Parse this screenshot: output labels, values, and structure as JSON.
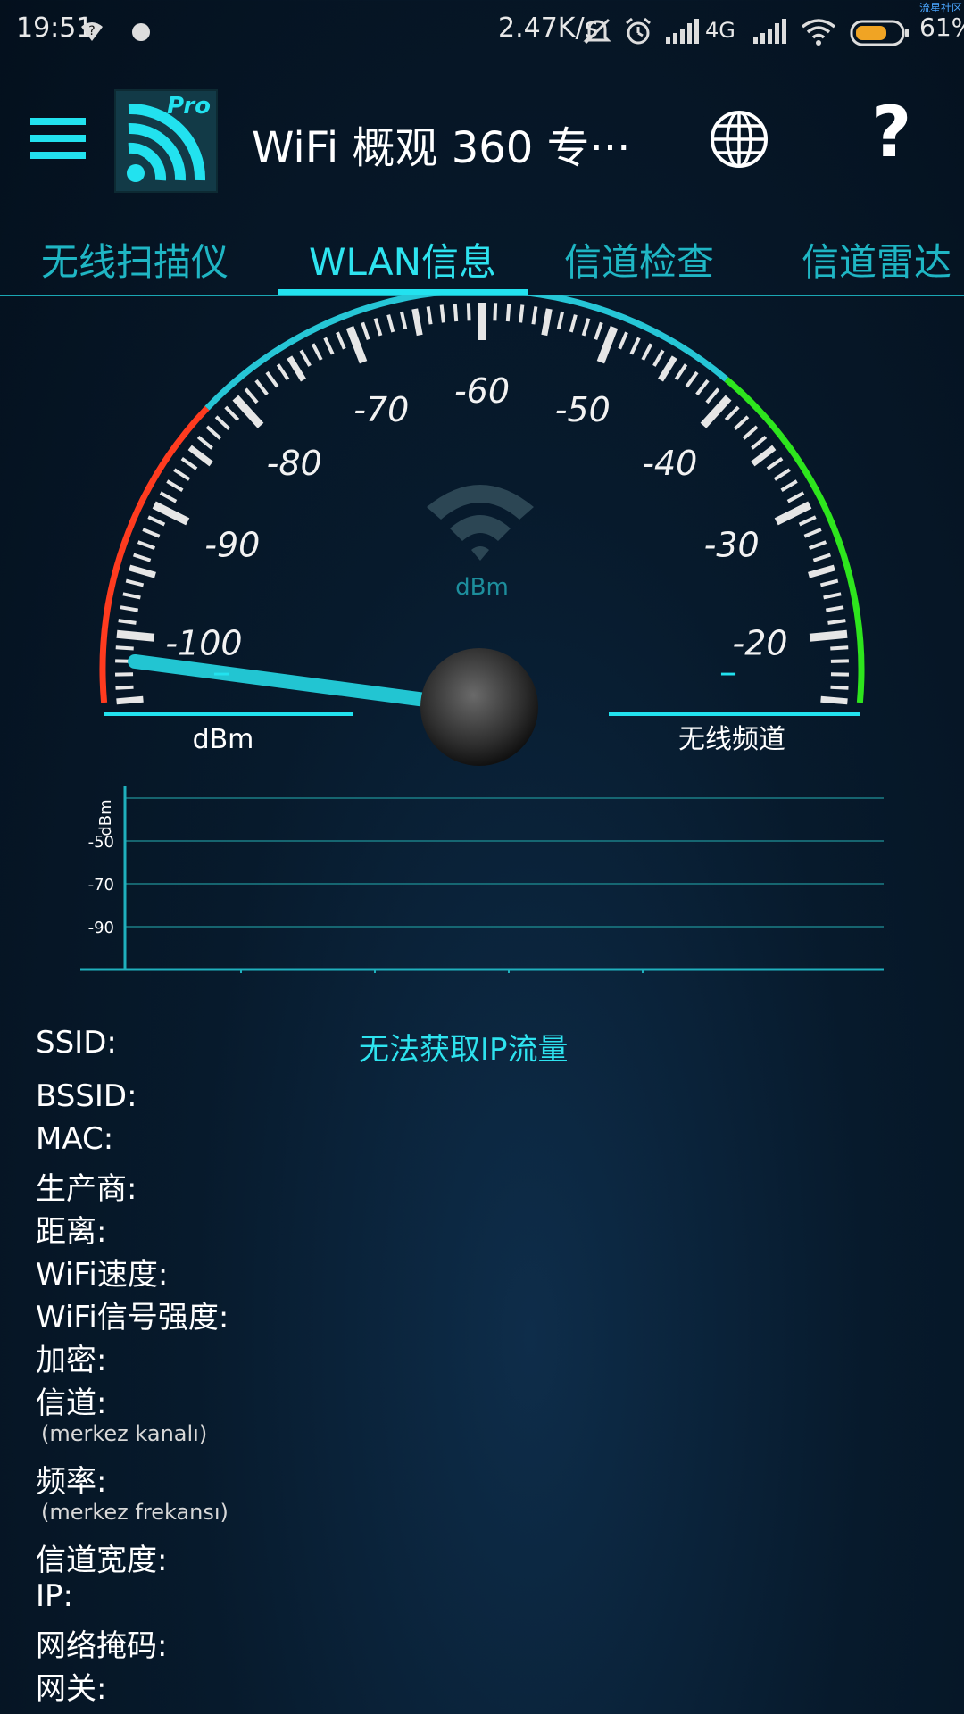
{
  "status_bar": {
    "time": "19:51",
    "net_speed": "2.47K/s",
    "network_type": "4G",
    "battery": "61%",
    "icons": [
      "help-circle-icon",
      "notification-dot-icon",
      "alarm-off-icon",
      "alarm-clock-icon",
      "signal-icon",
      "signal-icon",
      "wifi-icon",
      "battery-icon"
    ]
  },
  "watermark": "流星社区",
  "app": {
    "title": "WiFi 概观 360 专···",
    "logo_badge": "Pro",
    "menu_icon": "hamburger-icon",
    "globe_icon": "globe-icon",
    "help_label": "?"
  },
  "tabs": [
    {
      "label": "无线扫描仪"
    },
    {
      "label": "WLAN信息"
    },
    {
      "label": "信道检查"
    },
    {
      "label": "信道雷达"
    }
  ],
  "active_tab": 1,
  "gauge": {
    "ticks": [
      "-100",
      "-90",
      "-80",
      "-70",
      "-60",
      "-50",
      "-40",
      "-30",
      "-20"
    ],
    "min": -105,
    "max": -15,
    "value": -102,
    "unit": "dBm",
    "left_value": "–",
    "left_label": "dBm",
    "right_value": "–",
    "right_label": "无线频道",
    "colors": {
      "red": "#ff3b1f",
      "cyan": "#26c6d6",
      "green": "#2ee51d"
    }
  },
  "signal_chart": {
    "ylabel": "dBm",
    "y_ticks": [
      "-50",
      "-70",
      "-90"
    ]
  },
  "info": {
    "no_ip": "无法获取IP流量",
    "rows": [
      {
        "label": "SSID:"
      },
      {
        "label": "BSSID:"
      },
      {
        "label": "MAC:"
      },
      {
        "label": "生产商:"
      },
      {
        "label": "距离:"
      },
      {
        "label": "WiFi速度:"
      },
      {
        "label": "WiFi信号强度:"
      },
      {
        "label": "加密:"
      },
      {
        "label": "信道:"
      },
      {
        "label": "频率:"
      },
      {
        "label": "信道宽度:"
      },
      {
        "label": "IP:"
      },
      {
        "label": "网络掩码:"
      },
      {
        "label": "网关:"
      }
    ],
    "channel_note": "(merkez kanalı)",
    "freq_note": "(merkez frekansı)"
  }
}
